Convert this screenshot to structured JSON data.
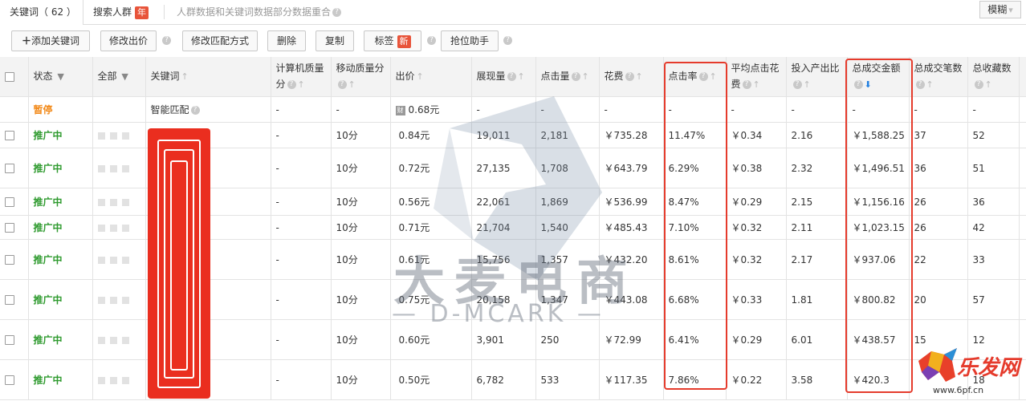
{
  "tabs": {
    "keywords": {
      "label": "关键词",
      "count": "（ 62 ）"
    },
    "crowd": {
      "label": "搜索人群",
      "badge": "年"
    },
    "notice": "人群数据和关键词数据部分数据重合"
  },
  "mode_select": "模糊",
  "toolbar": {
    "add": "添加关键词",
    "bid": "修改出价",
    "match": "修改匹配方式",
    "delete": "删除",
    "copy": "复制",
    "tag": "标签",
    "tag_badge": "新",
    "rank": "抢位助手"
  },
  "columns": {
    "status": "状态",
    "all": "全部",
    "keyword": "关键词",
    "pc_quality": "计算机质量分",
    "mobile_quality": "移动质量分",
    "bid": "出价",
    "impressions": "展现量",
    "clicks": "点击量",
    "cost": "花费",
    "ctr": "点击率",
    "avg_cpc": "平均点击花费",
    "roi": "投入产出比",
    "gmv": "总成交金额",
    "orders": "总成交笔数",
    "favorites": "总收藏数"
  },
  "smart_row": {
    "status": "暂停",
    "keyword": "智能匹配",
    "pc": "-",
    "mobile": "-",
    "bid": "0.68元",
    "impressions": "-",
    "clicks": "-",
    "cost": "-",
    "ctr": "-",
    "cpc": "-",
    "roi": "-",
    "gmv": "-",
    "orders": "-",
    "fav": "-"
  },
  "rows": [
    {
      "status": "推广中",
      "pc": "-",
      "mobile": "10分",
      "bid": "0.84元",
      "impressions": "19,011",
      "clicks": "2,181",
      "cost": "￥735.28",
      "ctr": "11.47%",
      "cpc": "￥0.34",
      "roi": "2.16",
      "gmv": "￥1,588.25",
      "orders": "37",
      "fav": "52"
    },
    {
      "status": "推广中",
      "pc": "-",
      "mobile": "10分",
      "bid": "0.72元",
      "impressions": "27,135",
      "clicks": "1,708",
      "cost": "￥643.79",
      "ctr": "6.29%",
      "cpc": "￥0.38",
      "roi": "2.32",
      "gmv": "￥1,496.51",
      "orders": "36",
      "fav": "51"
    },
    {
      "status": "推广中",
      "pc": "-",
      "mobile": "10分",
      "bid": "0.56元",
      "impressions": "22,061",
      "clicks": "1,869",
      "cost": "￥536.99",
      "ctr": "8.47%",
      "cpc": "￥0.29",
      "roi": "2.15",
      "gmv": "￥1,156.16",
      "orders": "26",
      "fav": "36"
    },
    {
      "status": "推广中",
      "pc": "-",
      "mobile": "10分",
      "bid": "0.71元",
      "impressions": "21,704",
      "clicks": "1,540",
      "cost": "￥485.43",
      "ctr": "7.10%",
      "cpc": "￥0.32",
      "roi": "2.11",
      "gmv": "￥1,023.15",
      "orders": "26",
      "fav": "42"
    },
    {
      "status": "推广中",
      "pc": "-",
      "mobile": "10分",
      "bid": "0.61元",
      "impressions": "15,756",
      "clicks": "1,357",
      "cost": "￥432.20",
      "ctr": "8.61%",
      "cpc": "￥0.32",
      "roi": "2.17",
      "gmv": "￥937.06",
      "orders": "22",
      "fav": "33"
    },
    {
      "status": "推广中",
      "pc": "-",
      "mobile": "10分",
      "bid": "0.75元",
      "impressions": "20,158",
      "clicks": "1,347",
      "cost": "￥443.08",
      "ctr": "6.68%",
      "cpc": "￥0.33",
      "roi": "1.81",
      "gmv": "￥800.82",
      "orders": "20",
      "fav": "57"
    },
    {
      "status": "推广中",
      "pc": "-",
      "mobile": "10分",
      "bid": "0.60元",
      "impressions": "3,901",
      "clicks": "250",
      "cost": "￥72.99",
      "ctr": "6.41%",
      "cpc": "￥0.29",
      "roi": "6.01",
      "gmv": "￥438.57",
      "orders": "15",
      "fav": "12"
    },
    {
      "status": "推广中",
      "pc": "-",
      "mobile": "10分",
      "bid": "0.50元",
      "impressions": "6,782",
      "clicks": "533",
      "cost": "￥117.35",
      "ctr": "7.86%",
      "cpc": "￥0.22",
      "roi": "3.58",
      "gmv": "￥420.3",
      "orders": "",
      "fav": "18"
    }
  ],
  "watermark": {
    "main": "大麦电商",
    "sub": "— D-MCARK —"
  },
  "corner_logo": {
    "text": "乐发网",
    "url": "www.6pf.cn"
  },
  "colors": {
    "active": "#2e9a2e",
    "paused": "#f28a1a",
    "highlight": "#e53b2c",
    "badge": "#e8543a"
  }
}
